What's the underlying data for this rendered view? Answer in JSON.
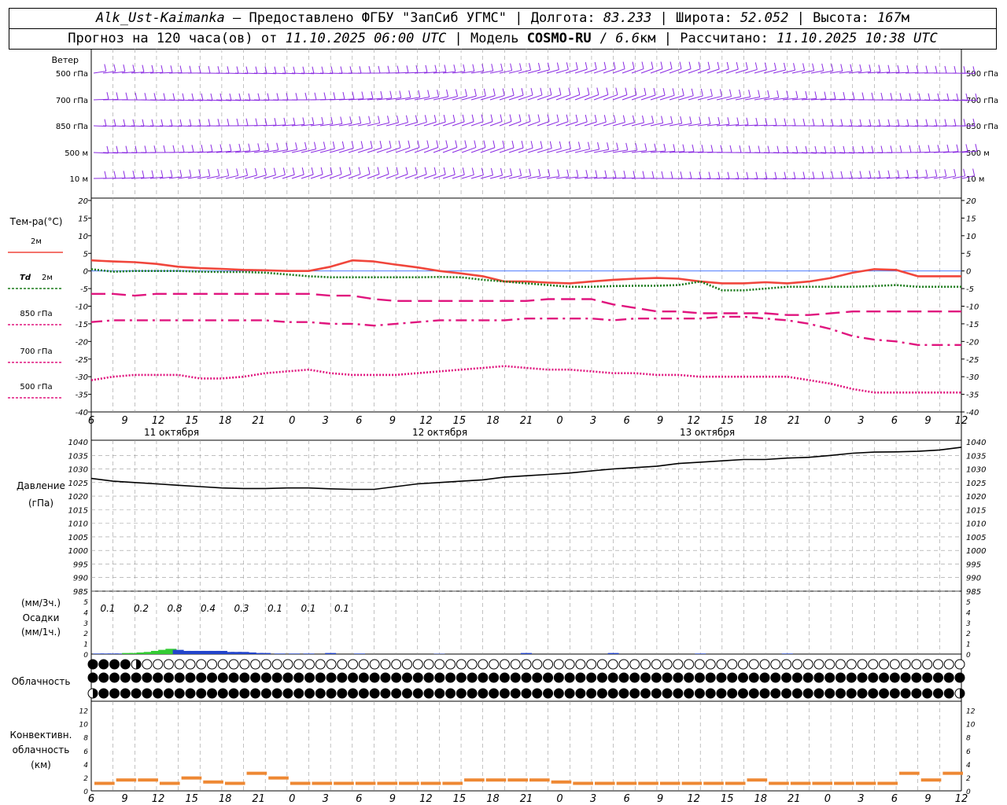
{
  "header": {
    "station": "Alk_Ust-Kaimanka",
    "provider": "Предоставлено ФГБУ \"ЗапСиб УГМС\"",
    "lon_label": "Долгота:",
    "lon_value": "83.233",
    "lat_label": "Широта:",
    "lat_value": "52.052",
    "alt_label": "Высота:",
    "alt_value": "167",
    "alt_unit": "м",
    "forecast_prefix": "Прогноз на 120 часа(ов) от",
    "forecast_start": "11.10.2025 06:00 UTC",
    "model_label": "Модель",
    "model_name": "COSMO-RU",
    "model_res": "6.6",
    "model_res_unit": "км",
    "computed_label": "Рассчитано:",
    "computed_time": "11.10.2025 10:38 UTC"
  },
  "time_axis": {
    "tick_labels": [
      "6",
      "9",
      "12",
      "15",
      "18",
      "21",
      "0",
      "3",
      "6",
      "9",
      "12",
      "15",
      "18",
      "21",
      "0",
      "3",
      "6",
      "9",
      "12",
      "15",
      "18",
      "21",
      "0",
      "3",
      "6",
      "9",
      "12"
    ],
    "day_labels": [
      "11 октября",
      "12 октября",
      "13 октября"
    ]
  },
  "wind_panel": {
    "title": "Ветер",
    "levels": [
      "500 гПа",
      "700 гПа",
      "850 гПа",
      "500 м",
      "10 м"
    ],
    "color": "#8a2be2"
  },
  "colors": {
    "t2m": "#f0463c",
    "td2m": "#1a7a1a",
    "t850": "#e0157e",
    "t700": "#e0157e",
    "t500": "#e0157e",
    "pressure": "#000000",
    "precip_green": "#33cc33",
    "precip_blue": "#2244cc",
    "convective": "#ee8833",
    "zero_line": "#3366ff"
  },
  "chart_data": [
    {
      "type": "line",
      "title": "Тем-ра(°C)",
      "x_hours": [
        0,
        3,
        6,
        9,
        12,
        15,
        18,
        21,
        24,
        27,
        30,
        33,
        36,
        39,
        42,
        45,
        48,
        51,
        54,
        57,
        60,
        63,
        66,
        69,
        72,
        75,
        78,
        81,
        84,
        87,
        90,
        93,
        96,
        99,
        102,
        105,
        108,
        111,
        114,
        117,
        120
      ],
      "ylim": [
        -40,
        20
      ],
      "yticks": [
        20,
        15,
        10,
        5,
        0,
        -5,
        -10,
        -15,
        -20,
        -25,
        -30,
        -35,
        -40
      ],
      "series": [
        {
          "name": "2м",
          "label": "2м",
          "style": "solid",
          "values": [
            3,
            2.7,
            2.5,
            2,
            1.2,
            0.8,
            0.6,
            0.3,
            0.2,
            0,
            0,
            1.2,
            3,
            2.7,
            1.8,
            1,
            0,
            -0.7,
            -1.5,
            -3,
            -3,
            -3.3,
            -3.5,
            -3,
            -2.5,
            -2.2,
            -2,
            -2.2,
            -3,
            -3.5,
            -3.5,
            -3.2,
            -3.5,
            -3,
            -2,
            -0.5,
            0.5,
            0.3,
            -1.5,
            -1.5,
            -1.5
          ]
        },
        {
          "name": "Td 2м",
          "label_prefix": "Td",
          "label": "2м",
          "style": "dotted",
          "values": [
            0.5,
            -0.2,
            0,
            0,
            0,
            -0.2,
            -0.3,
            -0.3,
            -0.5,
            -1,
            -1.5,
            -1.8,
            -1.8,
            -1.8,
            -1.8,
            -1.8,
            -1.7,
            -1.8,
            -2.5,
            -3,
            -3.5,
            -4,
            -4.5,
            -4.5,
            -4.3,
            -4.2,
            -4.2,
            -4,
            -3,
            -5.5,
            -5.5,
            -5,
            -4.5,
            -4.5,
            -4.5,
            -4.5,
            -4.3,
            -4,
            -4.5,
            -4.5,
            -4.5
          ]
        },
        {
          "name": "850 гПа",
          "label": "850 гПа",
          "style": "dashed",
          "values": [
            -6.5,
            -6.5,
            -7,
            -6.5,
            -6.5,
            -6.5,
            -6.5,
            -6.5,
            -6.5,
            -6.5,
            -6.5,
            -7,
            -7,
            -8,
            -8.5,
            -8.5,
            -8.5,
            -8.5,
            -8.5,
            -8.5,
            -8.5,
            -8,
            -8,
            -8,
            -9.5,
            -10.5,
            -11.5,
            -11.5,
            -12,
            -12,
            -12,
            -12,
            -12.5,
            -12.5,
            -12,
            -11.5,
            -11.5,
            -11.5,
            -11.5,
            -11.5,
            -11.5
          ]
        },
        {
          "name": "700 гПа",
          "label": "700 гПа",
          "style": "dashdot",
          "values": [
            -14.5,
            -14,
            -14,
            -14,
            -14,
            -14,
            -14,
            -14,
            -14,
            -14.5,
            -14.5,
            -15,
            -15,
            -15.5,
            -15,
            -14.5,
            -14,
            -14,
            -14,
            -14,
            -13.5,
            -13.5,
            -13.5,
            -13.5,
            -14,
            -13.5,
            -13.5,
            -13.5,
            -13.5,
            -13,
            -13,
            -13.5,
            -14,
            -15,
            -16.5,
            -18.5,
            -19.5,
            -20,
            -21,
            -21,
            -21
          ]
        },
        {
          "name": "500 гПа",
          "label": "500 гПа",
          "style": "dotted",
          "values": [
            -31,
            -30,
            -29.5,
            -29.5,
            -29.5,
            -30.5,
            -30.5,
            -30,
            -29,
            -28.5,
            -28,
            -29,
            -29.5,
            -29.5,
            -29.5,
            -29,
            -28.5,
            -28,
            -27.5,
            -27,
            -27.5,
            -28,
            -28,
            -28.5,
            -29,
            -29,
            -29.5,
            -29.5,
            -30,
            -30,
            -30,
            -30,
            -30,
            -31,
            -32,
            -33.5,
            -34.5,
            -34.5,
            -34.5,
            -34.5,
            -34.5
          ]
        }
      ]
    },
    {
      "type": "line",
      "title": "Давление",
      "unit": "(гПа)",
      "x_hours": [
        0,
        3,
        6,
        9,
        12,
        15,
        18,
        21,
        24,
        27,
        30,
        33,
        36,
        39,
        42,
        45,
        48,
        51,
        54,
        57,
        60,
        63,
        66,
        69,
        72,
        75,
        78,
        81,
        84,
        87,
        90,
        93,
        96,
        99,
        102,
        105,
        108,
        111,
        114,
        117,
        120
      ],
      "ylim": [
        985,
        1040
      ],
      "yticks": [
        1040,
        1035,
        1030,
        1025,
        1020,
        1015,
        1010,
        1005,
        1000,
        995,
        990,
        985
      ],
      "series": [
        {
          "name": "",
          "values": [
            1026.5,
            1025.5,
            1025,
            1024.5,
            1024,
            1023.5,
            1023,
            1022.8,
            1022.8,
            1023,
            1023,
            1022.7,
            1022.5,
            1022.5,
            1023.5,
            1024.5,
            1025,
            1025.5,
            1026,
            1027,
            1027.5,
            1028,
            1028.5,
            1029.3,
            1030,
            1030.5,
            1031,
            1032,
            1032.5,
            1033,
            1033.5,
            1033.5,
            1034,
            1034.3,
            1035,
            1035.8,
            1036.2,
            1036.3,
            1036.5,
            1037,
            1038
          ]
        }
      ]
    },
    {
      "type": "bar",
      "title": "Осадки",
      "unit_3h": "(мм/3ч.)",
      "unit_1h": "(мм/1ч.)",
      "ylim": [
        0,
        5
      ],
      "yticks": [
        5,
        4,
        3,
        2,
        1,
        0
      ],
      "totals_3h": [
        "0.1",
        "0.2",
        "0.8",
        "0.4",
        "0.3",
        "0.1",
        "0.1",
        "0.1"
      ],
      "hourly_x": [
        1,
        2,
        3,
        4,
        5,
        6,
        7,
        8,
        9,
        10,
        11,
        12,
        13,
        14,
        15,
        16,
        17,
        18,
        19,
        20,
        21,
        22,
        23,
        24,
        26,
        28,
        30,
        33,
        37,
        48,
        60,
        72,
        84,
        96
      ],
      "hourly_values": [
        0.05,
        0.05,
        0.05,
        0.05,
        0.1,
        0.1,
        0.15,
        0.2,
        0.3,
        0.4,
        0.5,
        0.4,
        0.3,
        0.3,
        0.3,
        0.3,
        0.3,
        0.3,
        0.2,
        0.2,
        0.2,
        0.15,
        0.1,
        0.1,
        0.05,
        0.05,
        0.05,
        0.1,
        0.05,
        0.03,
        0.1,
        0.1,
        0.05,
        0.05
      ],
      "hourly_phase": [
        "b",
        "b",
        "b",
        "b",
        "g",
        "g",
        "g",
        "g",
        "g",
        "g",
        "g",
        "b",
        "b",
        "b",
        "b",
        "b",
        "b",
        "b",
        "b",
        "b",
        "b",
        "b",
        "b",
        "b",
        "b",
        "b",
        "b",
        "b",
        "b",
        "b",
        "b",
        "b",
        "b",
        "b"
      ]
    },
    {
      "type": "table",
      "title": "Облачность",
      "rows": [
        [
          8,
          8,
          8,
          8,
          4,
          0,
          0,
          0,
          0,
          0,
          0,
          0,
          0,
          0,
          0,
          0,
          0,
          0,
          0,
          0,
          0,
          0,
          0,
          0,
          0,
          0,
          0,
          0,
          0,
          0,
          0,
          0,
          0,
          0,
          0,
          0,
          0,
          0,
          0,
          0,
          0,
          0,
          0,
          0,
          0,
          0,
          0,
          0,
          0,
          0,
          0,
          0,
          0,
          0,
          0,
          0,
          0,
          0,
          0,
          0,
          0,
          0,
          0,
          0,
          0,
          0,
          0,
          0,
          0,
          0,
          0,
          0,
          0,
          0,
          0,
          0,
          0,
          0,
          0,
          0,
          0
        ],
        [
          8,
          8,
          8,
          8,
          8,
          8,
          8,
          8,
          8,
          8,
          8,
          8,
          8,
          8,
          8,
          8,
          8,
          8,
          8,
          8,
          8,
          8,
          8,
          8,
          8,
          8,
          8,
          8,
          8,
          8,
          8,
          8,
          8,
          8,
          8,
          8,
          8,
          8,
          8,
          8,
          8,
          8,
          8,
          8,
          8,
          8,
          8,
          8,
          8,
          8,
          8,
          8,
          8,
          8,
          8,
          8,
          8,
          8,
          8,
          8,
          8,
          8,
          8,
          8,
          8,
          8,
          8,
          8,
          8,
          8,
          8,
          8,
          8,
          8,
          8,
          8,
          8,
          8,
          8,
          8,
          8
        ],
        [
          4,
          8,
          8,
          8,
          8,
          8,
          8,
          8,
          8,
          8,
          8,
          8,
          8,
          8,
          8,
          8,
          8,
          8,
          8,
          8,
          8,
          8,
          8,
          8,
          8,
          8,
          8,
          8,
          8,
          8,
          8,
          8,
          8,
          8,
          8,
          8,
          8,
          8,
          8,
          8,
          8,
          8,
          8,
          8,
          8,
          8,
          8,
          8,
          8,
          8,
          8,
          8,
          8,
          8,
          8,
          8,
          8,
          8,
          8,
          8,
          8,
          8,
          8,
          8,
          8,
          8,
          8,
          8,
          8,
          8,
          8,
          8,
          8,
          8,
          8,
          8,
          8,
          8,
          8,
          8,
          4
        ]
      ]
    },
    {
      "type": "bar",
      "title": "Конвективн. облачность",
      "unit": "(км)",
      "ylim": [
        0,
        13
      ],
      "yticks": [
        12,
        10,
        8,
        6,
        4,
        2,
        0
      ],
      "x_hours": [
        0,
        3,
        6,
        9,
        12,
        15,
        18,
        21,
        24,
        27,
        30,
        33,
        36,
        39,
        42,
        45,
        48,
        51,
        54,
        57,
        60,
        63,
        66,
        69,
        72,
        75,
        78,
        81,
        84,
        87,
        90,
        93,
        96,
        99,
        102,
        105,
        108,
        111,
        114,
        117
      ],
      "values": [
        1,
        1.5,
        1.5,
        1,
        1.8,
        1.2,
        1,
        2.5,
        1.8,
        1,
        1,
        1,
        1,
        1,
        1,
        1,
        1,
        1.5,
        1.5,
        1.5,
        1.5,
        1.2,
        1,
        1,
        1,
        1,
        1,
        1,
        1,
        1,
        1.5,
        1,
        1,
        1,
        1,
        1,
        1,
        2.5,
        1.5,
        2.5
      ]
    }
  ]
}
